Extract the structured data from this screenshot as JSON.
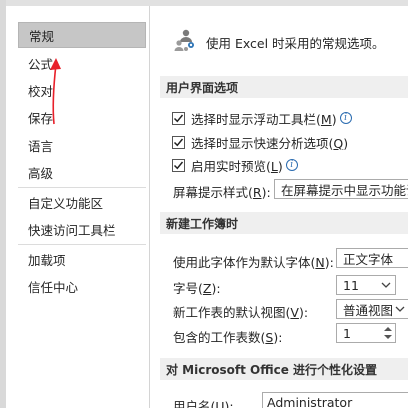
{
  "sidebar": {
    "items": [
      {
        "label": "常规",
        "active": true
      },
      {
        "label": "公式"
      },
      {
        "label": "校对"
      },
      {
        "label": "保存"
      },
      {
        "label": "语言"
      },
      {
        "label": "高级"
      },
      {
        "label": "自定义功能区"
      },
      {
        "label": "快速访问工具栏"
      },
      {
        "label": "加载项"
      },
      {
        "label": "信任中心"
      }
    ]
  },
  "general": {
    "intro": "使用 Excel 时采用的常规选项。",
    "ui_section": "用户界面选项",
    "opt_mini_toolbar": "选择时显示浮动工具栏(",
    "opt_mini_toolbar_key": "M",
    "opt_quick_analysis": "选择时显示快速分析选项(",
    "opt_quick_analysis_key": "Q",
    "opt_live_preview": "启用实时预览(",
    "opt_live_preview_key": "L",
    "screentip_label": "屏幕提示样式(",
    "screentip_key": "R",
    "screentip_value": "在屏幕提示中显示功能说明",
    "new_wb_section": "新建工作簿时",
    "font_label": "使用此字体作为默认字体(",
    "font_key": "N",
    "font_value": "正文字体",
    "size_label": "字号(",
    "size_key": "Z",
    "size_value": "11",
    "view_label": "新工作表的默认视图(",
    "view_key": "V",
    "view_value": "普通视图",
    "sheets_label": "包含的工作表数(",
    "sheets_key": "S",
    "sheets_value": "1",
    "personal_section": "对 Microsoft Office 进行个性化设置",
    "username_label": "用户名(",
    "username_key": "U",
    "username_value": "Administrator",
    "close_paren": ")",
    "close_paren_colon": "):"
  },
  "colors": {
    "active_bg": "#c6c6c6",
    "section_bg": "#efefef",
    "arrow": "#e8202a",
    "info": "#2b6cb0"
  }
}
